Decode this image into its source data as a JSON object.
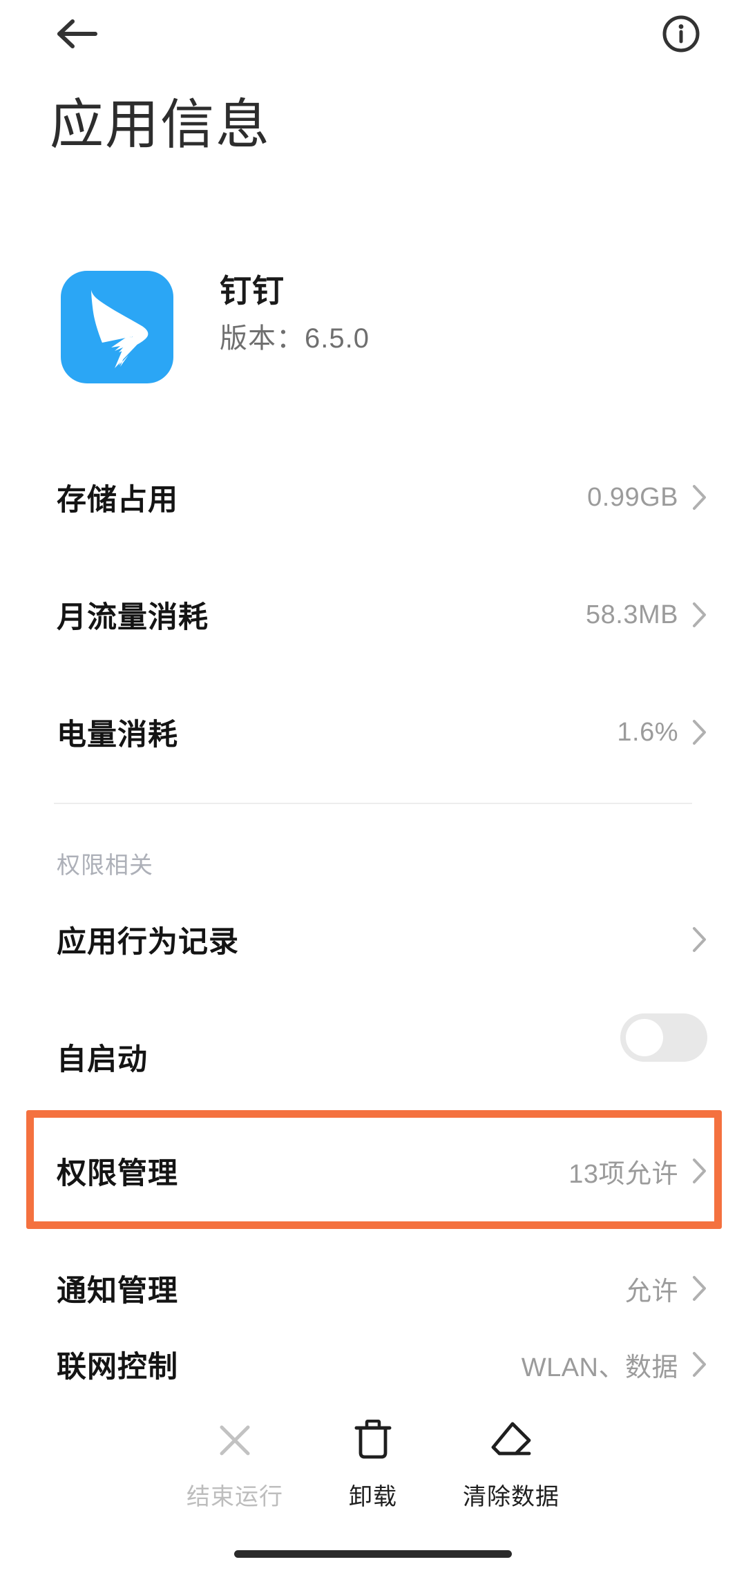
{
  "topbar": {
    "back_icon": "arrow-left-icon",
    "info_icon": "info-circle-icon"
  },
  "page_title": "应用信息",
  "app": {
    "icon_name": "dingtalk-app-icon",
    "icon_bg_color": "#2BA6F5",
    "name": "钉钉",
    "version": "版本：6.5.0"
  },
  "usage_rows": [
    {
      "label": "存储占用",
      "value": "0.99GB"
    },
    {
      "label": "月流量消耗",
      "value": "58.3MB"
    },
    {
      "label": "电量消耗",
      "value": "1.6%"
    }
  ],
  "section": {
    "header": "权限相关"
  },
  "permission_rows": [
    {
      "label": "应用行为记录",
      "value": ""
    },
    {
      "label": "自启动",
      "value": "",
      "toggle": "off"
    },
    {
      "label": "权限管理",
      "value": "13项允许"
    },
    {
      "label": "通知管理",
      "value": "允许"
    },
    {
      "label": "联网控制",
      "value": "WLAN、数据"
    }
  ],
  "highlight": {
    "target_label": "权限管理",
    "color": "#F4713F"
  },
  "bottom_actions": [
    {
      "label": "结束运行",
      "icon": "close-x-icon",
      "state": "disabled"
    },
    {
      "label": "卸载",
      "icon": "trash-icon",
      "state": "enabled"
    },
    {
      "label": "清除数据",
      "icon": "eraser-icon",
      "state": "enabled"
    }
  ],
  "gesture_bar": {
    "name": "home-indicator"
  }
}
